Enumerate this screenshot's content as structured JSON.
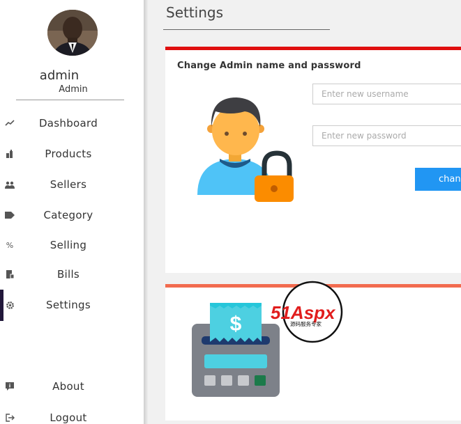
{
  "user": {
    "name": "admin",
    "role": "Admin"
  },
  "nav": [
    {
      "key": "dashboard",
      "label": "Dashboard",
      "icon": "chart-line-icon"
    },
    {
      "key": "products",
      "label": "Products",
      "icon": "bottles-icon"
    },
    {
      "key": "sellers",
      "label": "Sellers",
      "icon": "users-icon"
    },
    {
      "key": "category",
      "label": "Category",
      "icon": "tag-icon"
    },
    {
      "key": "selling",
      "label": "Selling",
      "icon": "percent-icon"
    },
    {
      "key": "bills",
      "label": "Bills",
      "icon": "receipt-icon"
    },
    {
      "key": "settings",
      "label": "Settings",
      "icon": "gear-icon",
      "active": true
    },
    {
      "key": "about",
      "label": "About",
      "icon": "info-icon"
    },
    {
      "key": "logout",
      "label": "Logout",
      "icon": "logout-icon"
    }
  ],
  "page": {
    "title": "Settings"
  },
  "admin_card": {
    "title": "Change Admin name and password",
    "username_placeholder": "Enter new username",
    "password_placeholder": "Enter new password",
    "button_label": "change"
  },
  "watermark": {
    "brand": "51Aspx",
    "subtitle": "源码服务专家"
  },
  "colors": {
    "card1_border": "#e00f0f",
    "card2_border": "#f26b4f",
    "button": "#2196f3",
    "active_indicator": "#21173a"
  }
}
